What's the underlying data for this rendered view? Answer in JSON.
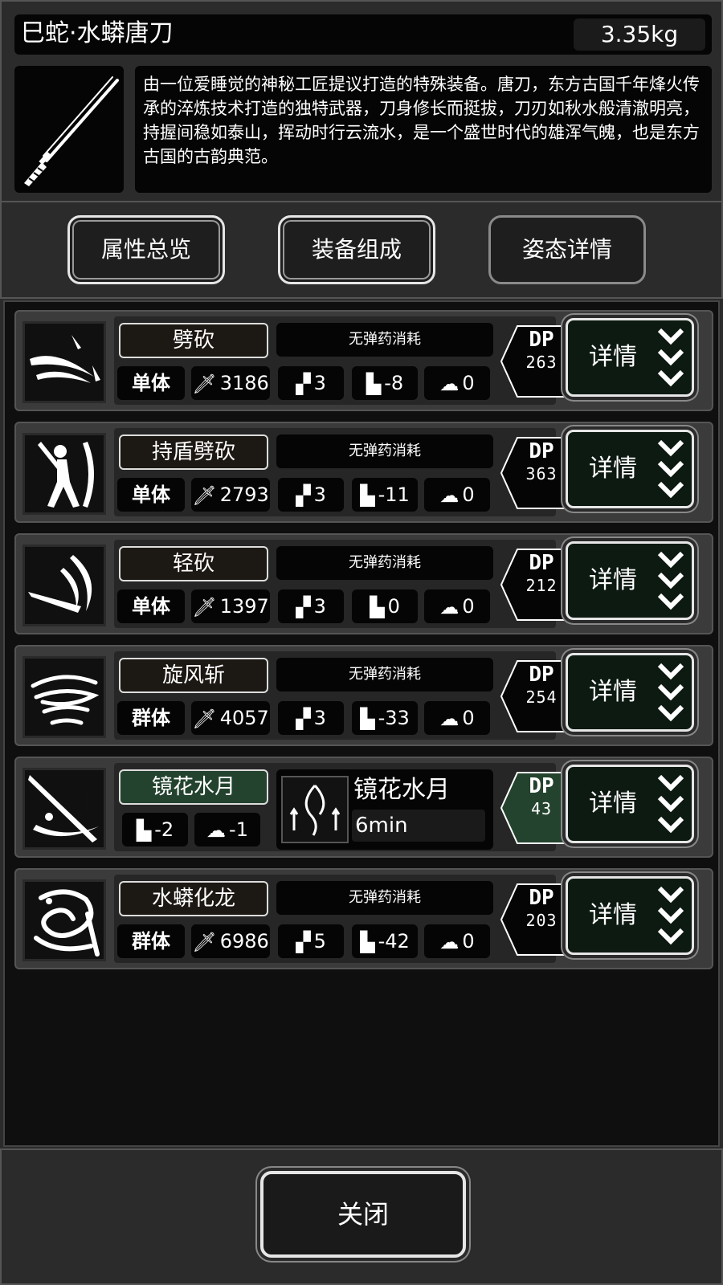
{
  "item": {
    "title": "巳蛇·水蟒唐刀",
    "weight": "3.35kg",
    "description": "由一位爱睡觉的神秘工匠提议打造的特殊装备。唐刀，东方古国千年烽火传承的淬炼技术打造的独特武器，刀身修长而挺拔，刀刃如秋水般清澈明亮，持握间稳如泰山，挥动时行云流水，是一个盛世时代的雄浑气魄，也是东方古国的古韵典范。"
  },
  "tabs": [
    {
      "label": "属性总览"
    },
    {
      "label": "装备组成"
    },
    {
      "label": "姿态详情"
    }
  ],
  "skills": [
    {
      "name": "劈砍",
      "ammo": "无弹药消耗",
      "target": "单体",
      "atk": "3186",
      "hit": "3",
      "spd": "-8",
      "brain": "0",
      "dp_label": "DP",
      "dp": "263",
      "detail": "详情"
    },
    {
      "name": "持盾劈砍",
      "ammo": "无弹药消耗",
      "target": "单体",
      "atk": "2793",
      "hit": "3",
      "spd": "-11",
      "brain": "0",
      "dp_label": "DP",
      "dp": "363",
      "detail": "详情"
    },
    {
      "name": "轻砍",
      "ammo": "无弹药消耗",
      "target": "单体",
      "atk": "1397",
      "hit": "3",
      "spd": "0",
      "brain": "0",
      "dp_label": "DP",
      "dp": "212",
      "detail": "详情"
    },
    {
      "name": "旋风斩",
      "ammo": "无弹药消耗",
      "target": "群体",
      "atk": "4057",
      "hit": "3",
      "spd": "-33",
      "brain": "0",
      "dp_label": "DP",
      "dp": "254",
      "detail": "详情"
    },
    {
      "name": "镜花水月",
      "buff_name": "镜花水月",
      "buff_time": "6min",
      "spd": "-2",
      "brain": "-1",
      "dp_label": "DP",
      "dp": "43",
      "detail": "详情"
    },
    {
      "name": "水蟒化龙",
      "ammo": "无弹药消耗",
      "target": "群体",
      "atk": "6986",
      "hit": "5",
      "spd": "-42",
      "brain": "0",
      "dp_label": "DP",
      "dp": "203",
      "detail": "详情"
    }
  ],
  "footer": {
    "close_label": "关闭"
  },
  "colors": {
    "special_green": "#23432e",
    "detail_bg": "#0d1a12",
    "panel": "#2b2b2b"
  }
}
